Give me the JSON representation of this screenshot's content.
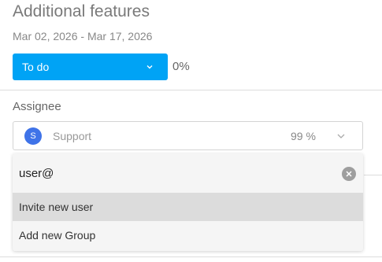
{
  "task": {
    "title": "Additional features",
    "date_range": "Mar 02, 2026 - Mar 17, 2026",
    "status": "To do",
    "progress": "0%"
  },
  "assignee": {
    "label": "Assignee",
    "avatar_initial": "S",
    "name": "Support",
    "percent": "99 %"
  },
  "dropdown": {
    "search_value": "user@",
    "options": [
      {
        "label": "Invite new user"
      },
      {
        "label": "Add new Group"
      }
    ]
  },
  "colors": {
    "status_bg": "#00a3f5",
    "avatar_bg": "#3f73e8",
    "highlight_bg": "#dcdcdc"
  },
  "icons": {
    "status_dropdown": "chevron-down-icon",
    "assignee_dropdown": "chevron-down-icon",
    "clear": "close-icon"
  }
}
